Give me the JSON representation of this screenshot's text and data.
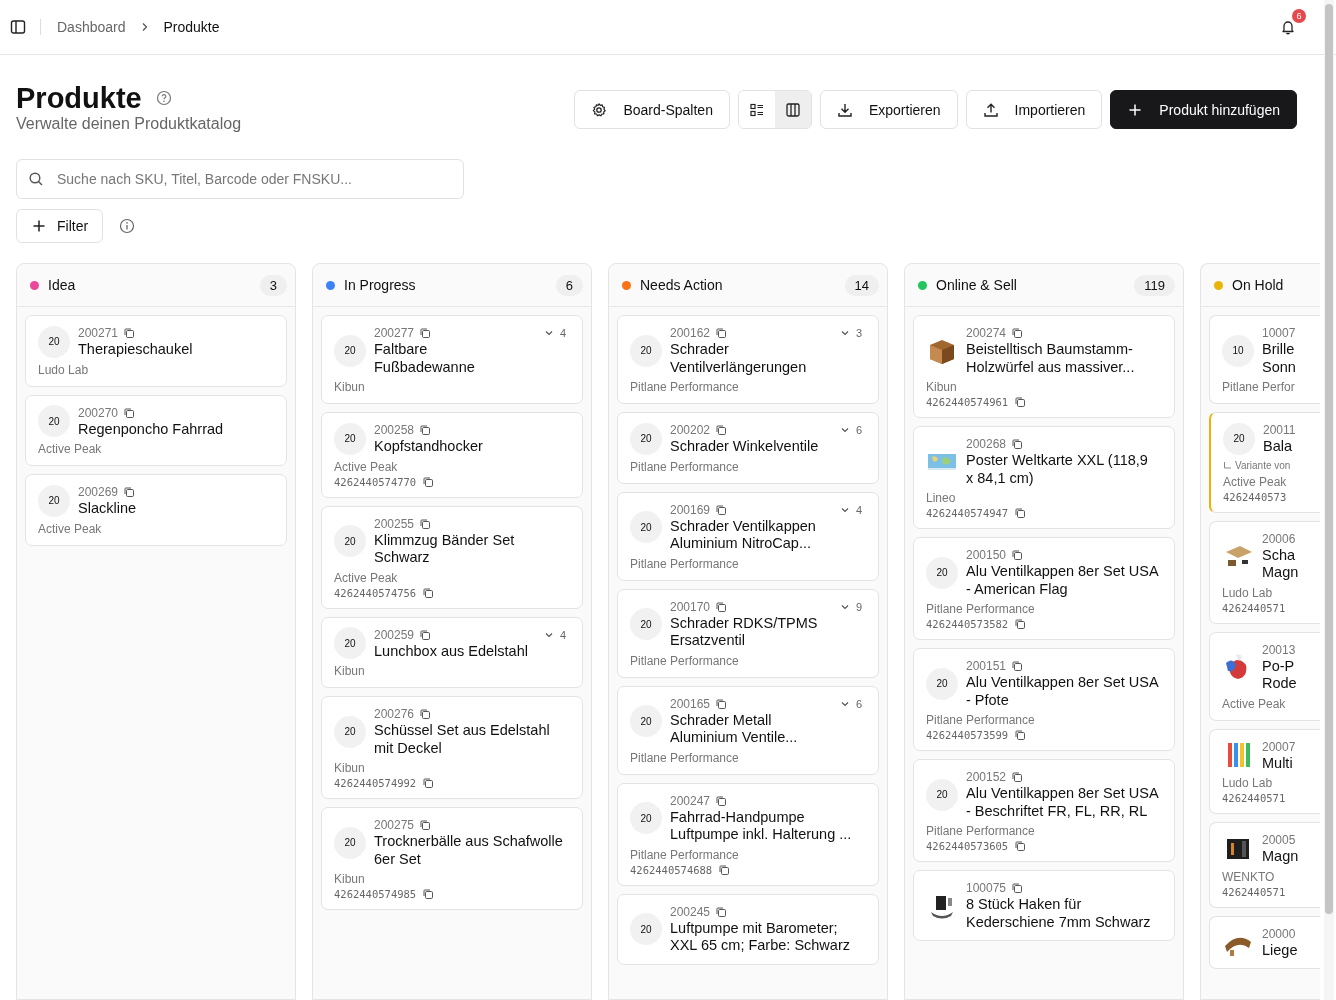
{
  "breadcrumb": [
    {
      "label": "Dashboard",
      "current": false
    },
    {
      "label": "Produkte",
      "current": true
    }
  ],
  "notifications": {
    "count": "6"
  },
  "page": {
    "title": "Produkte",
    "subtitle": "Verwalte deinen Produktkatalog"
  },
  "toolbar": {
    "board_columns": "Board-Spalten",
    "view_toggle": [
      {
        "kind": "list",
        "selected": false
      },
      {
        "kind": "board",
        "selected": true
      }
    ],
    "export": "Exportieren",
    "import": "Importieren",
    "add": "Produkt hinzufügen"
  },
  "search": {
    "placeholder": "Suche nach SKU, Titel, Barcode oder FNSKU..."
  },
  "filter": {
    "label": "Filter"
  },
  "columns": [
    {
      "name": "Idea",
      "color": "#ec4899",
      "count": "3",
      "clipped": false,
      "cards": [
        {
          "kind": "avatar",
          "avatar": "20",
          "sku": "200271",
          "title": "Therapieschaukel",
          "brand": "Ludo Lab"
        },
        {
          "kind": "avatar",
          "avatar": "20",
          "sku": "200270",
          "title": "Regenponcho Fahrrad",
          "brand": "Active Peak"
        },
        {
          "kind": "avatar",
          "avatar": "20",
          "sku": "200269",
          "title": "Slackline",
          "brand": "Active Peak"
        }
      ]
    },
    {
      "name": "In Progress",
      "color": "#3b82f6",
      "count": "6",
      "clipped": false,
      "cards": [
        {
          "kind": "avatar",
          "avatar": "20",
          "sku": "200277",
          "title": "Faltbare Fußbadewanne",
          "brand": "Kibun",
          "variants": "4"
        },
        {
          "kind": "avatar",
          "avatar": "20",
          "sku": "200258",
          "title": "Kopfstandhocker",
          "brand": "Active Peak",
          "barcode": "4262440574770"
        },
        {
          "kind": "avatar",
          "avatar": "20",
          "sku": "200255",
          "title": "Klimmzug Bänder Set Schwarz",
          "brand": "Active Peak",
          "barcode": "4262440574756"
        },
        {
          "kind": "avatar",
          "avatar": "20",
          "sku": "200259",
          "title": "Lunchbox aus Edelstahl",
          "brand": "Kibun",
          "variants": "4"
        },
        {
          "kind": "avatar",
          "avatar": "20",
          "sku": "200276",
          "title": "Schüssel Set aus Edelstahl mit Deckel",
          "brand": "Kibun",
          "barcode": "4262440574992"
        },
        {
          "kind": "avatar",
          "avatar": "20",
          "sku": "200275",
          "title": "Trocknerbälle aus Schafwolle 6er Set",
          "brand": "Kibun",
          "barcode": "4262440574985"
        }
      ]
    },
    {
      "name": "Needs Action",
      "color": "#f97316",
      "count": "14",
      "clipped": false,
      "cards": [
        {
          "kind": "avatar",
          "avatar": "20",
          "sku": "200162",
          "title": "Schrader Ventilverlängerungen",
          "brand": "Pitlane Performance",
          "variants": "3"
        },
        {
          "kind": "avatar",
          "avatar": "20",
          "sku": "200202",
          "title": "Schrader Winkelventile",
          "brand": "Pitlane Performance",
          "variants": "6"
        },
        {
          "kind": "avatar",
          "avatar": "20",
          "sku": "200169",
          "title": "Schrader Ventilkappen Aluminium NitroCap...",
          "brand": "Pitlane Performance",
          "variants": "4"
        },
        {
          "kind": "avatar",
          "avatar": "20",
          "sku": "200170",
          "title": "Schrader RDKS/TPMS Ersatzventil",
          "brand": "Pitlane Performance",
          "variants": "9"
        },
        {
          "kind": "avatar",
          "avatar": "20",
          "sku": "200165",
          "title": "Schrader Metall Aluminium Ventile...",
          "brand": "Pitlane Performance",
          "variants": "6"
        },
        {
          "kind": "avatar",
          "avatar": "20",
          "sku": "200247",
          "title": "Fahrrad-Handpumpe Luftpumpe inkl. Halterung ...",
          "brand": "Pitlane Performance",
          "barcode": "4262440574688"
        },
        {
          "kind": "avatar",
          "avatar": "20",
          "sku": "200245",
          "title": "Luftpumpe mit Barometer; XXL 65 cm; Farbe: Schwarz"
        }
      ]
    },
    {
      "name": "Online & Sell",
      "color": "#22c55e",
      "count": "119",
      "clipped": false,
      "cards": [
        {
          "kind": "picture",
          "sku": "200274",
          "title": "Beistelltisch Baumstamm-Holzwürfel aus massiver...",
          "brand": "Kibun",
          "barcode": "4262440574961"
        },
        {
          "kind": "picture",
          "sku": "200268",
          "title": "Poster Weltkarte XXL (118,9 x 84,1 cm)",
          "brand": "Lineo",
          "barcode": "4262440574947"
        },
        {
          "kind": "avatar",
          "avatar": "20",
          "sku": "200150",
          "title": "Alu Ventilkappen 8er Set USA - American Flag",
          "brand": "Pitlane Performance",
          "barcode": "4262440573582"
        },
        {
          "kind": "avatar",
          "avatar": "20",
          "sku": "200151",
          "title": "Alu Ventilkappen 8er Set USA - Pfote",
          "brand": "Pitlane Performance",
          "barcode": "4262440573599"
        },
        {
          "kind": "avatar",
          "avatar": "20",
          "sku": "200152",
          "title": "Alu Ventilkappen 8er Set USA - Beschriftet FR, FL, RR, RL",
          "brand": "Pitlane Performance",
          "barcode": "4262440573605"
        },
        {
          "kind": "picture",
          "sku": "100075",
          "title": "8 Stück Haken für Kederschiene 7mm Schwarz"
        }
      ]
    },
    {
      "name": "On Hold",
      "color": "#eab308",
      "clipped": true,
      "cards": [
        {
          "kind": "avatar",
          "avatar": "10",
          "sku": "10007",
          "title": "Brille Sonn",
          "brand": "Pitlane Perfor",
          "highlighted": false
        },
        {
          "kind": "avatar",
          "avatar": "20",
          "sku": "20011",
          "title": "Bala",
          "variant_of": "Variante von",
          "brand": "Active Peak",
          "barcode": "4262440573",
          "highlighted": true
        },
        {
          "kind": "picture",
          "sku": "20006",
          "title": "Scha Magn",
          "brand": "Ludo Lab",
          "barcode": "4262440571",
          "highlighted": false
        },
        {
          "kind": "picture",
          "sku": "20013",
          "title": "Po-P Rode",
          "brand": "Active Peak",
          "highlighted": false
        },
        {
          "kind": "picture",
          "sku": "20007",
          "title": "Multi",
          "brand": "Ludo Lab",
          "barcode": "4262440571",
          "highlighted": false
        },
        {
          "kind": "picture",
          "sku": "20005",
          "title": "Magn",
          "brand": "WENKTO",
          "barcode": "4262440571",
          "highlighted": false
        },
        {
          "kind": "picture",
          "sku": "20000",
          "title": "Liege",
          "highlighted": false
        }
      ]
    }
  ]
}
